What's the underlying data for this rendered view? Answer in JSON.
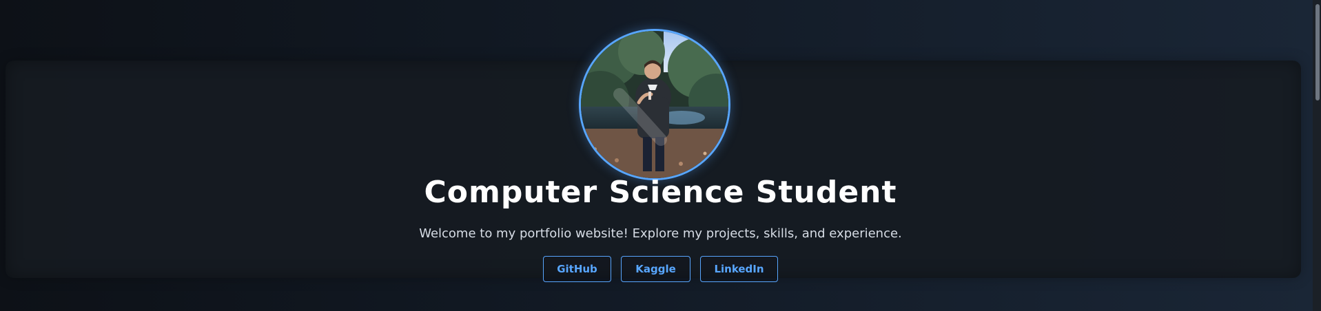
{
  "hero": {
    "title": "Computer Science Student",
    "subtitle": "Welcome to my portfolio website! Explore my projects, skills, and experience.",
    "links": [
      {
        "label": "GitHub"
      },
      {
        "label": "Kaggle"
      },
      {
        "label": "LinkedIn"
      }
    ],
    "accent_color": "#58a6ff"
  },
  "theme": {
    "background": "#0d1117",
    "text_color": "#ffffff"
  }
}
